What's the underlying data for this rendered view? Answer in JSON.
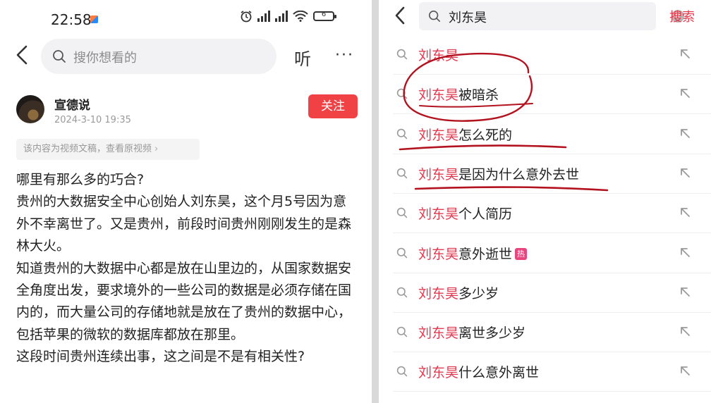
{
  "left": {
    "status": {
      "time": "22:58",
      "battery": "6"
    },
    "search": {
      "placeholder": "搜你想看的"
    },
    "listen_label": "听",
    "more_label": "···",
    "author": {
      "name": "宣德说",
      "date": "2024-3-10 19:35"
    },
    "follow_label": "关注",
    "notice": "该内容为视频文稿，查看原视频",
    "article": [
      "哪里有那么多的巧合?",
      "贵州的大数据安全中心创始人刘东昊，这个月5号因为意外不幸离世了。又是贵州，前段时间贵州刚刚发生的是森林大火。",
      "知道贵州的大数据中心都是放在山里边的，从国家数据安全角度出发，要求境外的一些公司的数据是必须存储在国内的，而大量公司的存储地就是放在了贵州的数据中心，包括苹果的微软的数据库都放在那里。",
      "这段时间贵州连续出事，这之间是不是有相关性?"
    ]
  },
  "right": {
    "query": "刘东昊",
    "submit_label": "搜索",
    "suggestions": [
      {
        "keyword": "刘东昊",
        "rest": ""
      },
      {
        "keyword": "刘东昊",
        "rest": "被暗杀"
      },
      {
        "keyword": "刘东昊",
        "rest": "怎么死的"
      },
      {
        "keyword": "刘东昊",
        "rest": "是因为什么意外去世"
      },
      {
        "keyword": "刘东昊",
        "rest": "个人简历"
      },
      {
        "keyword": "刘东昊",
        "rest": "意外逝世",
        "badge": "热"
      },
      {
        "keyword": "刘东昊",
        "rest": "多少岁"
      },
      {
        "keyword": "刘东昊",
        "rest": "离世多少岁"
      },
      {
        "keyword": "刘东昊",
        "rest": "什么意外离世"
      }
    ]
  },
  "colors": {
    "accent": "#e23a4f",
    "follow": "#f04245",
    "annotation": "#b3121f"
  }
}
